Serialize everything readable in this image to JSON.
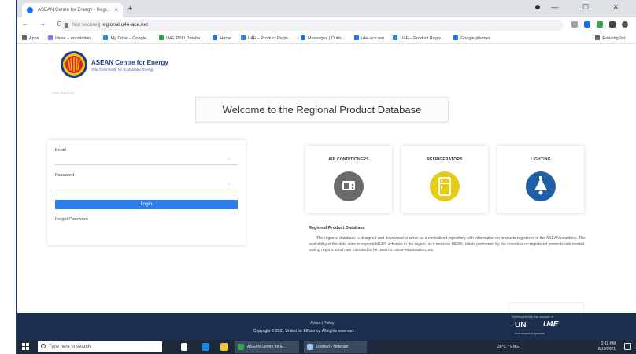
{
  "browser": {
    "tab_title": "ASEAN Centre for Energy - Regi...",
    "tab_close": "×",
    "new_tab": "+",
    "address_prefix": "Not secure",
    "address_url": "regional.u4e-ace.net",
    "nav_buttons": "← → C",
    "window_controls": "— ☐ ✕",
    "bookmarks": [
      {
        "label": "Apps",
        "color": "#5f6368"
      },
      {
        "label": "Ideas – annotation...",
        "color": "#6b7cff"
      },
      {
        "label": "My Drive – Google...",
        "color": "#1e88e5"
      },
      {
        "label": "U4E PPO Databa...",
        "color": "#34a853"
      },
      {
        "label": "Home",
        "color": "#1a73e8"
      },
      {
        "label": "U4E – Product Regis...",
        "color": "#2b7de9"
      },
      {
        "label": "Messages | Outlo...",
        "color": "#1976d2"
      },
      {
        "label": "u4e-ace.net",
        "color": "#1a73e8"
      },
      {
        "label": "U4E – Product Regis...",
        "color": "#2b7de9"
      },
      {
        "label": "Google planner",
        "color": "#1a73e8"
      }
    ],
    "reading_list": "Reading list"
  },
  "site": {
    "logo_title": "ASEAN Centre for Energy",
    "logo_subtitle": "One Community for Sustainable Energy",
    "breadcrumb": "ACE Data hub",
    "welcome_heading": "Welcome to the Regional Product Database"
  },
  "login": {
    "email_label": "Email",
    "email_value": "",
    "password_label": "Password",
    "password_value": "",
    "login_button": "Login",
    "forgot_link": "Forgot Password"
  },
  "products": [
    {
      "label": "AIR CONDITIONERS",
      "color": "#6b6b6b",
      "icon": "air-conditioner-icon"
    },
    {
      "label": "REFRIGERATORS",
      "color": "#e6cc17",
      "icon": "refrigerator-icon"
    },
    {
      "label": "LIGHTING",
      "color": "#1f5fa8",
      "icon": "lamp-icon"
    }
  ],
  "description": {
    "title": "Regional Product Database",
    "body": "The regional database is designed and developed to serve as a centralized repository with information on products registered in the ASEAN countries. The availability of the data aims to support MEPS activities in the region, as it includes MEPS, labels performed by the countries on registered products and market testing reports which are intended to be used for cross-examination, etc."
  },
  "footer": {
    "links": "About  |  Policy",
    "copyright": "Copyright © 2021 United for Efficiency. All rights reserved.",
    "partner_label": "Developed with the support of",
    "partner_un": "UN",
    "partner_u4e": "U4E",
    "partner_sub": "environment programme"
  },
  "taskbar": {
    "search_placeholder": "Type here to search",
    "app_1": "ASEAN Centre for E...",
    "app_2": "Untitled - Notepad",
    "tray_status": "26°C  ^  ENG",
    "time": "2:11 PM",
    "date": "8/10/2021"
  },
  "colors": {
    "accent": "#2b7de9",
    "footer_bg": "#1a2f4e",
    "taskbar_bg": "#1c2a3c"
  }
}
